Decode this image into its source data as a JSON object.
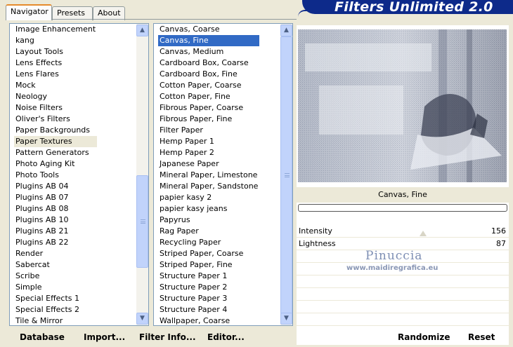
{
  "tabs": [
    {
      "label": "Navigator",
      "active": true
    },
    {
      "label": "Presets",
      "active": false
    },
    {
      "label": "About",
      "active": false
    }
  ],
  "banner_title": "Filters Unlimited 2.0",
  "categories": [
    "Image Enhancement",
    "kang",
    "Layout Tools",
    "Lens Effects",
    "Lens Flares",
    "Mock",
    "Neology",
    "Noise Filters",
    "Oliver's Filters",
    "Paper Backgrounds",
    "Paper Textures",
    "Pattern Generators",
    "Photo Aging Kit",
    "Photo Tools",
    "Plugins AB 04",
    "Plugins AB 07",
    "Plugins AB 08",
    "Plugins AB 10",
    "Plugins AB 21",
    "Plugins AB 22",
    "Render",
    "Sabercat",
    "Scribe",
    "Simple",
    "Special Effects 1",
    "Special Effects 2",
    "Tile & Mirror"
  ],
  "selected_category": "Paper Textures",
  "filters": [
    "Canvas, Coarse",
    "Canvas, Fine",
    "Canvas, Medium",
    "Cardboard Box, Coarse",
    "Cardboard Box, Fine",
    "Cotton Paper, Coarse",
    "Cotton Paper, Fine",
    "Fibrous Paper, Coarse",
    "Fibrous Paper, Fine",
    "Filter Paper",
    "Hemp Paper 1",
    "Hemp Paper 2",
    "Japanese Paper",
    "Mineral Paper, Limestone",
    "Mineral Paper, Sandstone",
    "papier kasy 2",
    "papier kasy jeans",
    "Papyrus",
    "Rag Paper",
    "Recycling Paper",
    "Striped Paper, Coarse",
    "Striped Paper, Fine",
    "Structure Paper 1",
    "Structure Paper 2",
    "Structure Paper 3",
    "Structure Paper 4",
    "Wallpaper, Coarse"
  ],
  "selected_filter": "Canvas, Fine",
  "current_filter_name": "Canvas, Fine",
  "params": [
    {
      "label": "Intensity",
      "value": "156"
    },
    {
      "label": "Lightness",
      "value": "87"
    }
  ],
  "watermark": {
    "name": "Pinuccia",
    "url": "www.maidiregrafica.eu"
  },
  "buttons": {
    "database": "Database",
    "import": "Import...",
    "filter_info": "Filter Info...",
    "editor": "Editor...",
    "randomize": "Randomize",
    "reset": "Reset"
  },
  "icons": {
    "scroll_up": "scroll-up-arrow-icon",
    "scroll_down": "scroll-down-arrow-icon"
  }
}
